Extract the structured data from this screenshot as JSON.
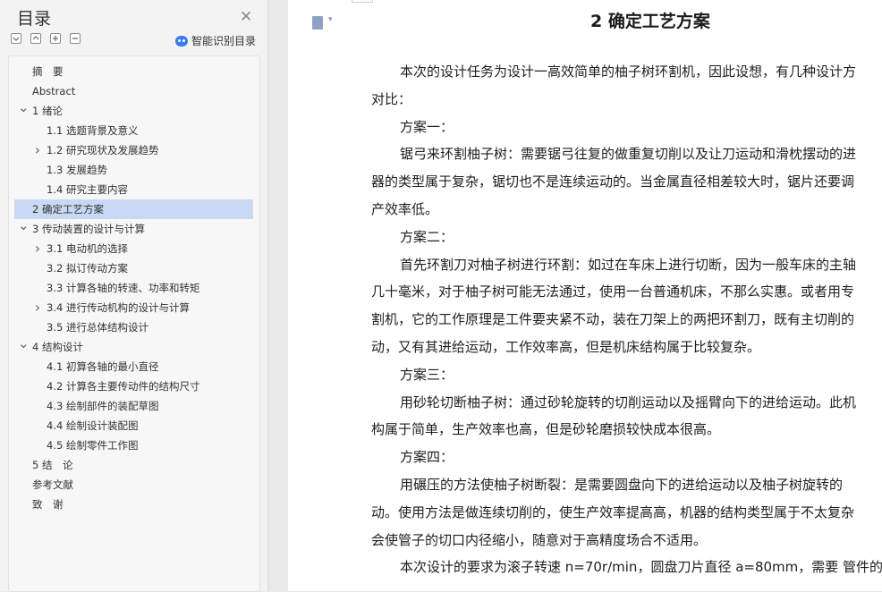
{
  "toc": {
    "title": "目录",
    "smart_label": "智能识别目录",
    "items": [
      {
        "label": "摘　要",
        "level": 0,
        "chevron": ""
      },
      {
        "label": "Abstract",
        "level": 0,
        "chevron": ""
      },
      {
        "label": "1 绪论",
        "level": 0,
        "chevron": "expanded"
      },
      {
        "label": "1.1 选题背景及意义",
        "level": 1,
        "chevron": ""
      },
      {
        "label": "1.2 研究现状及发展趋势",
        "level": 1,
        "chevron": "collapsed"
      },
      {
        "label": "1.3 发展趋势",
        "level": 1,
        "chevron": ""
      },
      {
        "label": "1.4 研究主要内容",
        "level": 1,
        "chevron": ""
      },
      {
        "label": "2 确定工艺方案",
        "level": 0,
        "chevron": "",
        "selected": true
      },
      {
        "label": "3 传动装置的设计与计算",
        "level": 0,
        "chevron": "expanded"
      },
      {
        "label": "3.1 电动机的选择",
        "level": 1,
        "chevron": "collapsed"
      },
      {
        "label": "3.2 拟订传动方案",
        "level": 1,
        "chevron": ""
      },
      {
        "label": "3.3 计算各轴的转速、功率和转矩",
        "level": 1,
        "chevron": ""
      },
      {
        "label": "3.4 进行传动机构的设计与计算",
        "level": 1,
        "chevron": "collapsed"
      },
      {
        "label": "3.5 进行总体结构设计",
        "level": 1,
        "chevron": ""
      },
      {
        "label": "4 结构设计",
        "level": 0,
        "chevron": "expanded"
      },
      {
        "label": "4.1 初算各轴的最小直径",
        "level": 1,
        "chevron": ""
      },
      {
        "label": "4.2 计算各主要传动件的结构尺寸",
        "level": 1,
        "chevron": ""
      },
      {
        "label": "4.3 绘制部件的装配草图",
        "level": 1,
        "chevron": ""
      },
      {
        "label": "4.4 绘制设计装配图",
        "level": 1,
        "chevron": ""
      },
      {
        "label": "4.5 绘制零件工作图",
        "level": 1,
        "chevron": ""
      },
      {
        "label": "5 结　论",
        "level": 0,
        "chevron": ""
      },
      {
        "label": "参考文献",
        "level": 0,
        "chevron": ""
      },
      {
        "label": "致　谢",
        "level": 0,
        "chevron": ""
      }
    ]
  },
  "document": {
    "heading": "2 确定工艺方案",
    "lines": [
      "本次的设计任务为设计一高效简单的柚子树环割机，因此设想，有几种设计方",
      "对比：",
      "方案一：",
      "锯弓来环割柚子树：需要锯弓往复的做重复切削以及让刀运动和滑枕摆动的进",
      "器的类型属于复杂，锯切也不是连续运动的。当金属直径相差较大时，锯片还要调",
      "产效率低。",
      "方案二：",
      "首先环割刀对柚子树进行环割：如过在车床上进行切断，因为一般车床的主轴",
      "几十毫米，对于柚子树可能无法通过，使用一台普通机床，不那么实惠。或者用专",
      "割机，它的工作原理是工件要夹紧不动，装在刀架上的两把环割刀，既有主切削的",
      "动，又有其进给运动，工作效率高，但是机床结构属于比较复杂。",
      "方案三：",
      "用砂轮切断柚子树：通过砂轮旋转的切削运动以及摇臂向下的进给运动。此机",
      "构属于简单，生产效率也高，但是砂轮磨损较快成本很高。",
      "方案四：",
      "用碾压的方法使柚子树断裂：是需要圆盘向下的进给运动以及柚子树旋转的",
      "动。使用方法是做连续切削的，使生产效率提高高，机器的结构类型属于不太复杂",
      "会使管子的切口内径缩小，随意对于高精度场合不适用。",
      "本次设计的要求为滚子转速 n=70r/min，圆盘刀片直径 a=80mm，需要 管件的"
    ]
  }
}
